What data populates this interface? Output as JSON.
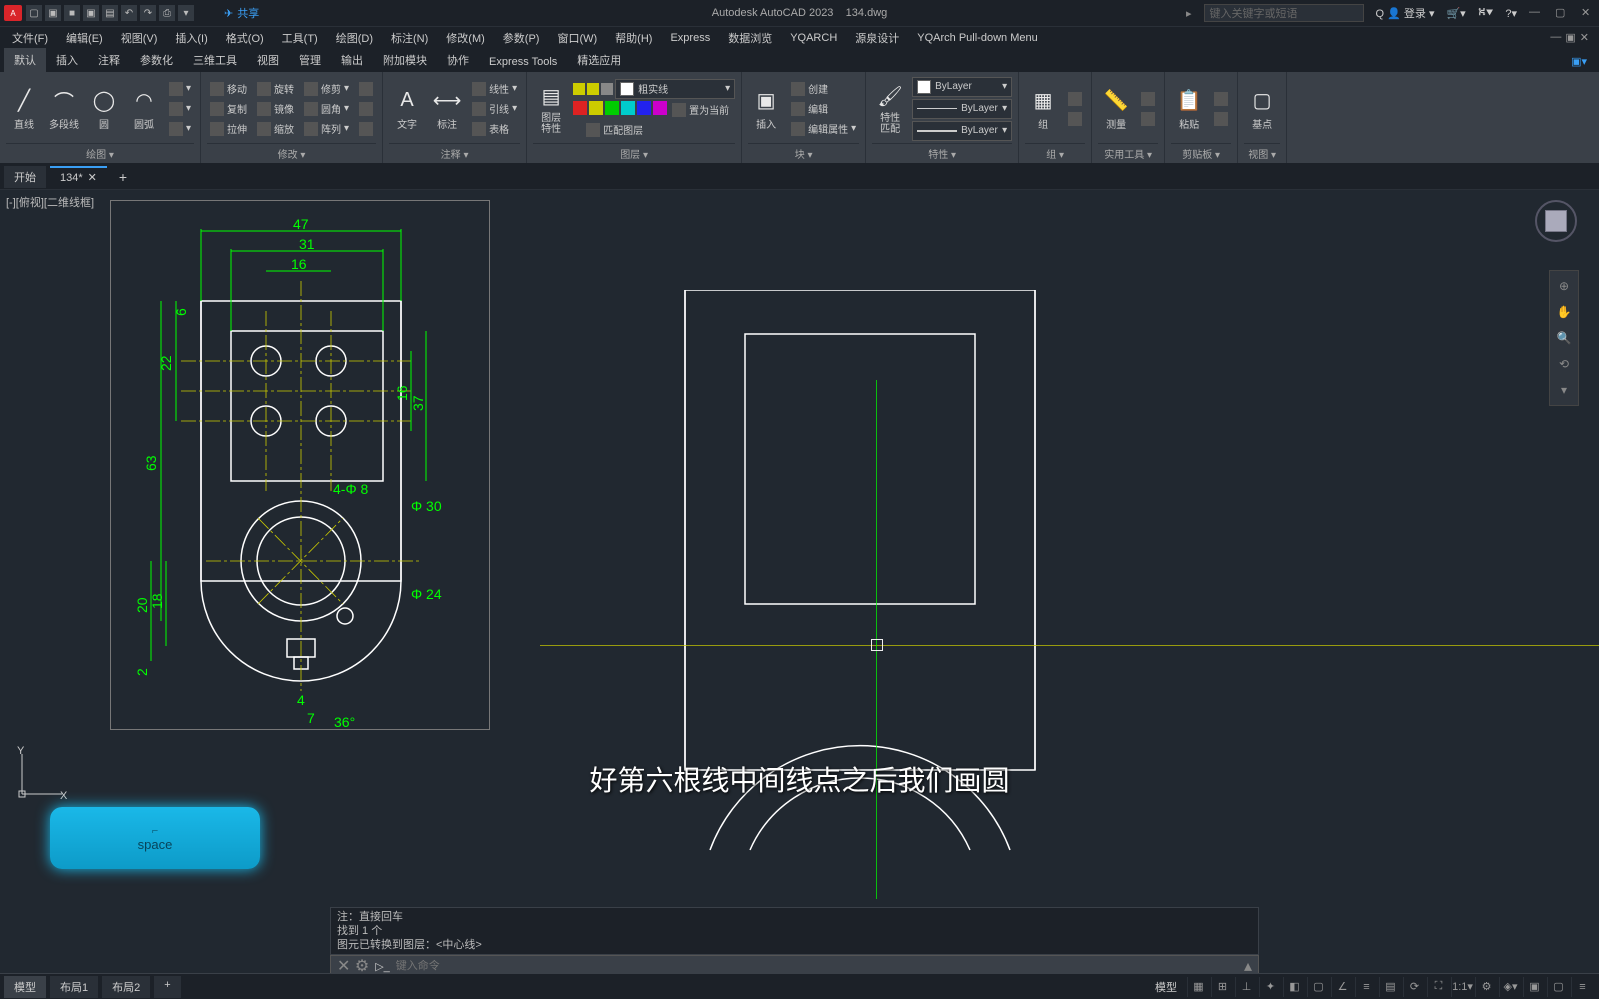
{
  "app": {
    "name": "Autodesk AutoCAD 2023",
    "file": "134.dwg",
    "share": "共享"
  },
  "search_placeholder": "键入关键字或短语",
  "login": "登录",
  "menu": [
    "文件(F)",
    "编辑(E)",
    "视图(V)",
    "插入(I)",
    "格式(O)",
    "工具(T)",
    "绘图(D)",
    "标注(N)",
    "修改(M)",
    "参数(P)",
    "窗口(W)",
    "帮助(H)",
    "Express",
    "数据浏览",
    "YQARCH",
    "源泉设计",
    "YQArch Pull-down Menu"
  ],
  "ribbon_tabs": [
    "默认",
    "插入",
    "注释",
    "参数化",
    "三维工具",
    "视图",
    "管理",
    "输出",
    "附加模块",
    "协作",
    "Express Tools",
    "精选应用"
  ],
  "panels": {
    "draw": {
      "label": "绘图 ▾",
      "btns": {
        "line": "直线",
        "pline": "多段线",
        "circle": "圆",
        "arc": "圆弧"
      }
    },
    "modify": {
      "label": "修改 ▾",
      "r1": "移动",
      "r2": "复制",
      "r3": "拉伸",
      "c1": "旋转",
      "c2": "镜像",
      "c3": "缩放",
      "d1": "修剪",
      "d2": "圆角",
      "d3": "阵列"
    },
    "annot": {
      "label": "注释 ▾",
      "text": "文字",
      "dim": "标注",
      "t1": "线性",
      "t2": "引线",
      "t3": "表格"
    },
    "layer": {
      "label": "图层 ▾",
      "prop": "图层\n特性",
      "current": "粗实线",
      "b1": "置为当前",
      "b2": "匹配图层"
    },
    "block": {
      "label": "块 ▾",
      "insert": "插入",
      "c1": "创建",
      "c2": "编辑",
      "c3": "编辑属性"
    },
    "props": {
      "label": "特性 ▾",
      "match": "特性\n匹配",
      "bylayer": "ByLayer"
    },
    "group": {
      "label": "组 ▾",
      "g": "组"
    },
    "util": {
      "label": "实用工具 ▾",
      "m": "测量"
    },
    "clip": {
      "label": "剪贴板 ▾",
      "p": "粘贴"
    },
    "view": {
      "label": "视图 ▾",
      "b": "基点"
    }
  },
  "doc_tabs": {
    "start": "开始",
    "file": "134*"
  },
  "viewport_label": "[-][俯视][二维线框]",
  "dims": {
    "d47": "47",
    "d31": "31",
    "d16": "16",
    "d6": "6",
    "d22": "22",
    "d63": "63",
    "d16v": "16",
    "d37": "37",
    "n4phi8": "4-Φ 8",
    "phi30": "Φ 30",
    "phi24": "Φ 24",
    "d18": "18",
    "d20": "20",
    "d2": "2",
    "d4": "4",
    "d7": "7",
    "a36": "36°"
  },
  "subtitle": "好第六根线中间线点之后我们画圆",
  "key": {
    "name": "space",
    "hint": "⌐"
  },
  "cmd": {
    "h1": "注：直接回车",
    "h2": "找到 1 个",
    "h3": "图元已转换到图层：<中心线>",
    "placeholder": "键入命令"
  },
  "layout_tabs": {
    "model": "模型",
    "l1": "布局1",
    "l2": "布局2"
  },
  "status": {
    "model": "模型"
  }
}
